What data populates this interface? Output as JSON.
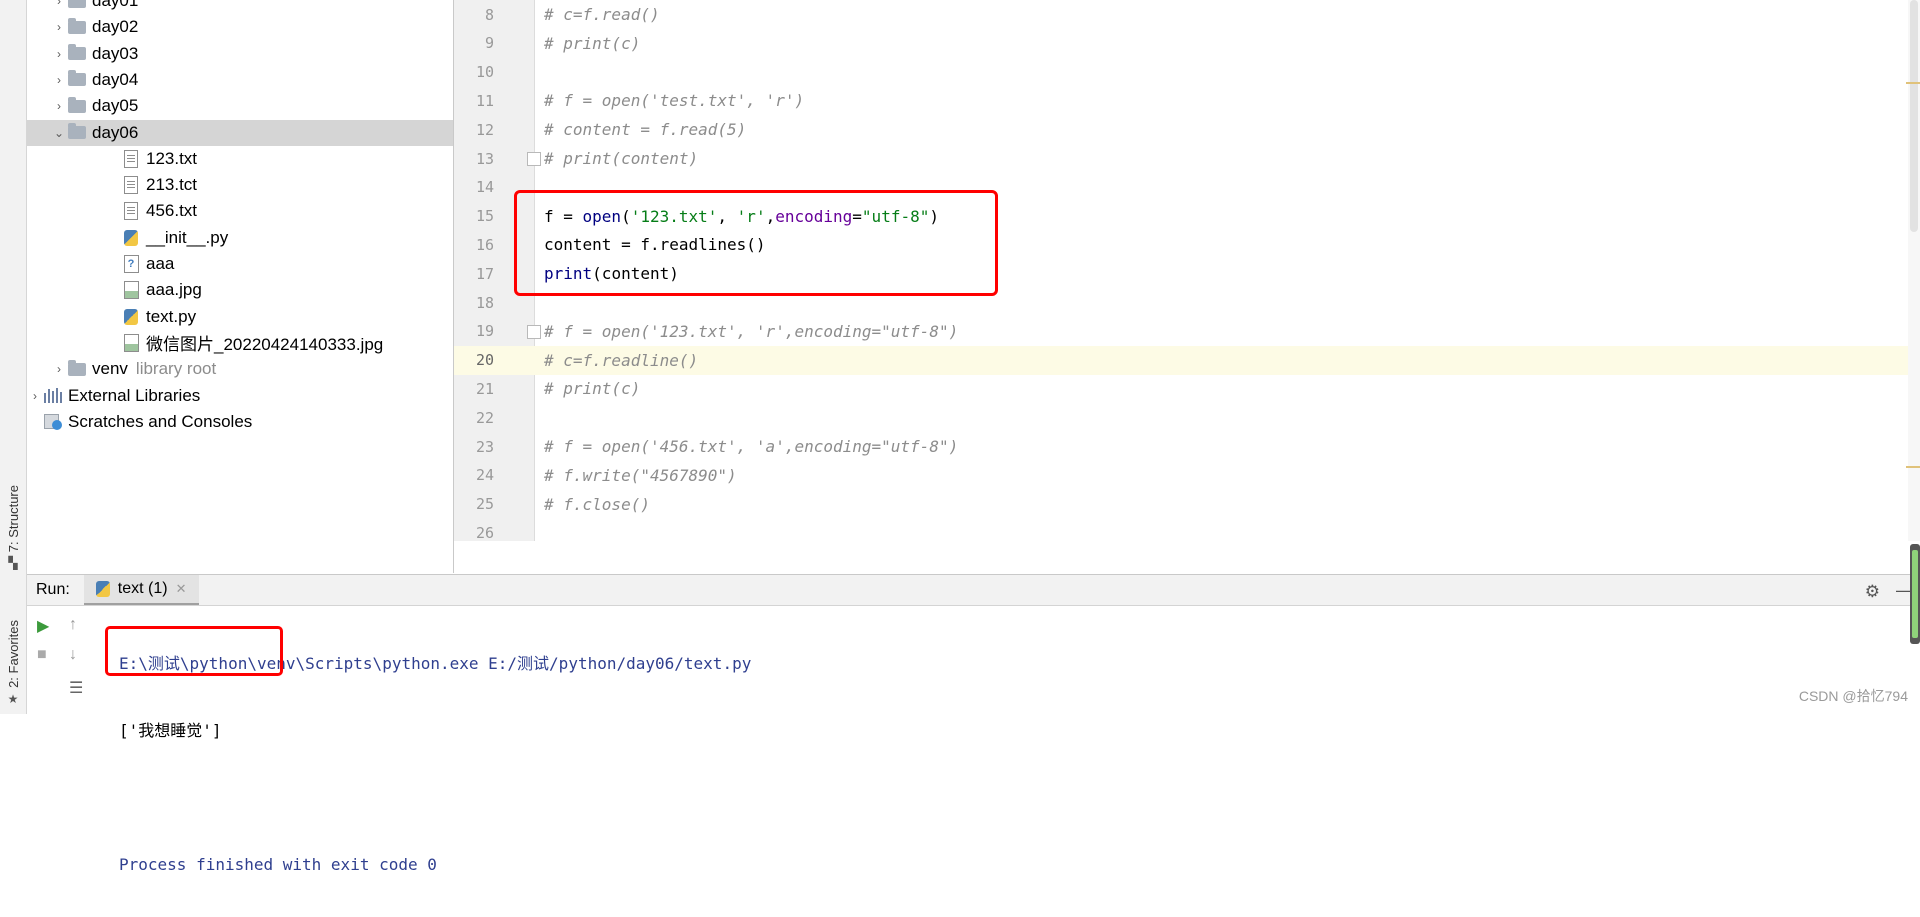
{
  "toolstrip": {
    "structure_label": "7: Structure",
    "favorites_label": "2: Favorites"
  },
  "project_tree": [
    {
      "label": "day01",
      "type": "folder",
      "arrow": "›"
    },
    {
      "label": "day02",
      "type": "folder",
      "arrow": "›"
    },
    {
      "label": "day03",
      "type": "folder",
      "arrow": "›"
    },
    {
      "label": "day04",
      "type": "folder",
      "arrow": "›"
    },
    {
      "label": "day05",
      "type": "folder",
      "arrow": "›"
    },
    {
      "label": "day06",
      "type": "folder",
      "arrow": "⌄",
      "selected": true
    },
    {
      "label": "123.txt",
      "type": "file"
    },
    {
      "label": "213.tct",
      "type": "file"
    },
    {
      "label": "456.txt",
      "type": "file"
    },
    {
      "label": "__init__.py",
      "type": "python"
    },
    {
      "label": "aaa",
      "type": "unknown"
    },
    {
      "label": "aaa.jpg",
      "type": "image"
    },
    {
      "label": "text.py",
      "type": "python"
    },
    {
      "label": "微信图片_20220424140333.jpg",
      "type": "image"
    },
    {
      "label": "venv",
      "type": "folder",
      "arrow": "›",
      "hint": "library root"
    },
    {
      "label": "External Libraries",
      "type": "library",
      "arrow": "›"
    },
    {
      "label": "Scratches and Consoles",
      "type": "scratch"
    }
  ],
  "editor": {
    "caret_line": "20",
    "lines": [
      {
        "n": "8",
        "text": "# c=f.read()"
      },
      {
        "n": "9",
        "text": "# print(c)"
      },
      {
        "n": "10",
        "text": ""
      },
      {
        "n": "11",
        "text": "# f = open('test.txt', 'r')"
      },
      {
        "n": "12",
        "text": "# content = f.read(5)"
      },
      {
        "n": "13",
        "text": "# print(content)"
      },
      {
        "n": "14",
        "text": ""
      },
      {
        "n": "15",
        "text": "f = open('123.txt', 'r',encoding=\"utf-8\")"
      },
      {
        "n": "16",
        "text": "content = f.readlines()"
      },
      {
        "n": "17",
        "text": "print(content)"
      },
      {
        "n": "18",
        "text": ""
      },
      {
        "n": "19",
        "text": "# f = open('123.txt', 'r',encoding=\"utf-8\")"
      },
      {
        "n": "20",
        "text": "# c=f.readline()"
      },
      {
        "n": "21",
        "text": "# print(c)"
      },
      {
        "n": "22",
        "text": ""
      },
      {
        "n": "23",
        "text": "# f = open('456.txt', 'a',encoding=\"utf-8\")"
      },
      {
        "n": "24",
        "text": "# f.write(\"4567890\")"
      },
      {
        "n": "25",
        "text": "# f.close()"
      },
      {
        "n": "26",
        "text": ""
      }
    ]
  },
  "run_panel": {
    "label": "Run:",
    "tab_label": "text (1)",
    "console": [
      "E:\\测试\\python\\venv\\Scripts\\python.exe E:/测试/python/day06/text.py",
      "['我想睡觉']",
      "",
      "Process finished with exit code 0"
    ]
  },
  "watermark": "CSDN @拾忆794",
  "colors": {
    "highlight_box": "#ff0000",
    "comment": "#8c8c8c",
    "string": "#067d17",
    "keyword": "#000080"
  }
}
